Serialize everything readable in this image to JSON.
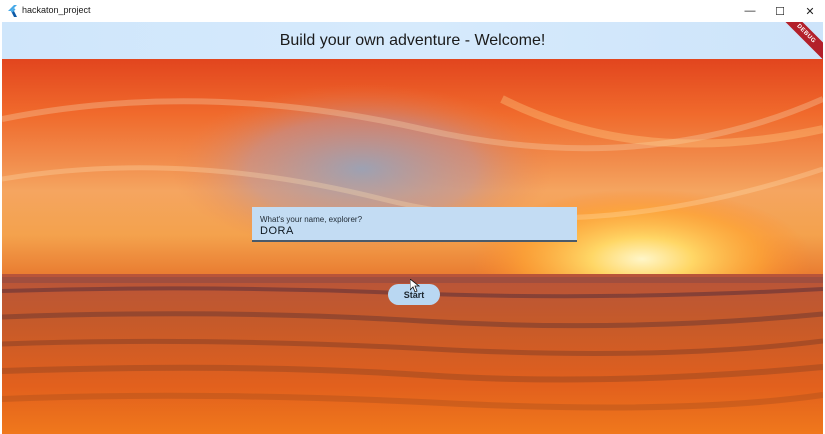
{
  "window": {
    "title": "hackaton_project",
    "controls": {
      "minimize": "—",
      "maximize": "☐",
      "close": "✕"
    }
  },
  "appbar": {
    "title": "Build your own adventure - Welcome!",
    "debug_banner": "DEBUG"
  },
  "form": {
    "name_label": "What's your name, explorer?",
    "name_value": "DORA",
    "start_label": "Start"
  },
  "colors": {
    "appbar": "#d6eafc",
    "field": "#c3dcf3",
    "button": "#b9d7f2",
    "debug": "#b3202a"
  }
}
